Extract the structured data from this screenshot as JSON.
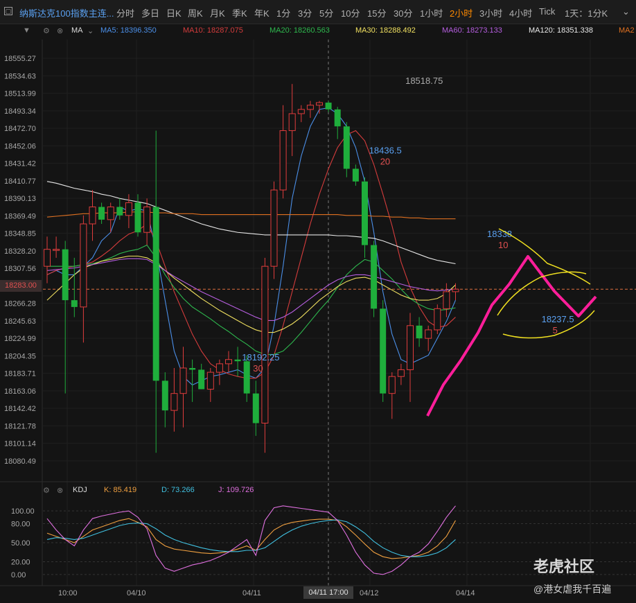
{
  "toolbar": {
    "symbol": "纳斯达克100指数主连...",
    "timeframes": [
      "分时",
      "多日",
      "日K",
      "周K",
      "月K",
      "季K",
      "年K",
      "1分",
      "3分",
      "5分",
      "10分",
      "15分",
      "30分",
      "1小时",
      "2小时",
      "3小时",
      "4小时",
      "Tick",
      "1天：1分K"
    ],
    "active_timeframe": "2小时"
  },
  "ma_bar": {
    "label": "MA",
    "items": [
      {
        "text": "MA5: 18396.350",
        "color": "#4b8fe8"
      },
      {
        "text": "MA10: 18287.075",
        "color": "#d43c3c"
      },
      {
        "text": "MA20: 18260.563",
        "color": "#2eb84e"
      },
      {
        "text": "MA30: 18288.492",
        "color": "#f0e060"
      },
      {
        "text": "MA60: 18273.133",
        "color": "#b65ee0"
      },
      {
        "text": "MA120: 18351.338",
        "color": "#e8e8e8"
      },
      {
        "text": "MA2",
        "color": "#e07020"
      }
    ]
  },
  "kdj_bar": {
    "label": "KDJ",
    "items": [
      {
        "text": "K: 85.419",
        "color": "#f0a040"
      },
      {
        "text": "D: 73.266",
        "color": "#40c0e0"
      },
      {
        "text": "J: 109.726",
        "color": "#e070e0"
      }
    ]
  },
  "price_chip": "18283.00",
  "crosshair_label": "04/11 17:00",
  "watermark": "老虎社区",
  "author": "@港女虐我千百遍",
  "colors": {
    "up": "#e03c3c",
    "down": "#1fae3c",
    "bg": "#141414",
    "grid": "#262626"
  },
  "chart_data": {
    "type": "candlestick",
    "y_ticks": [
      "18555.27",
      "18534.63",
      "18513.99",
      "18493.34",
      "18472.70",
      "18452.06",
      "18431.42",
      "18410.77",
      "18390.13",
      "18369.49",
      "18348.85",
      "18328.20",
      "18307.56",
      "18266.28",
      "18245.63",
      "18224.99",
      "18204.35",
      "18183.71",
      "18163.06",
      "18142.42",
      "18121.78",
      "18101.14",
      "18080.49"
    ],
    "ylim": [
      18060,
      18575
    ],
    "x_labels": [
      "10:00",
      "04/10",
      "04/11",
      "04/12",
      "04/14"
    ],
    "current_price": 18283.0,
    "annotations": [
      {
        "label": "18518.75",
        "x": 41,
        "y": 18518.75
      },
      {
        "label": "18436.5",
        "sub": "20",
        "x": 37,
        "y": 18436.5
      },
      {
        "label": "18338",
        "sub": "10",
        "x": 50,
        "y": 18338
      },
      {
        "label": "18237.5",
        "sub": "5",
        "x": 56,
        "y": 18237.5
      },
      {
        "label": "18192.25",
        "sub": "30",
        "x": 23,
        "y": 18192.25
      }
    ],
    "candles": [
      {
        "o": 18310,
        "h": 18345,
        "l": 18290,
        "c": 18330
      },
      {
        "o": 18330,
        "h": 18345,
        "l": 18320,
        "c": 18330
      },
      {
        "o": 18330,
        "h": 18340,
        "l": 18160,
        "c": 18270
      },
      {
        "o": 18270,
        "h": 18320,
        "l": 18250,
        "c": 18262
      },
      {
        "o": 18262,
        "h": 18370,
        "l": 18220,
        "c": 18360
      },
      {
        "o": 18360,
        "h": 18400,
        "l": 18340,
        "c": 18380
      },
      {
        "o": 18380,
        "h": 18385,
        "l": 18360,
        "c": 18365
      },
      {
        "o": 18365,
        "h": 18385,
        "l": 18350,
        "c": 18380
      },
      {
        "o": 18380,
        "h": 18390,
        "l": 18365,
        "c": 18370
      },
      {
        "o": 18370,
        "h": 18395,
        "l": 18355,
        "c": 18385
      },
      {
        "o": 18385,
        "h": 18395,
        "l": 18345,
        "c": 18350
      },
      {
        "o": 18350,
        "h": 18390,
        "l": 18335,
        "c": 18380
      },
      {
        "o": 18380,
        "h": 18470,
        "l": 18090,
        "c": 18175
      },
      {
        "o": 18175,
        "h": 18185,
        "l": 18120,
        "c": 18140
      },
      {
        "o": 18140,
        "h": 18190,
        "l": 18115,
        "c": 18160
      },
      {
        "o": 18160,
        "h": 18215,
        "l": 18120,
        "c": 18190
      },
      {
        "o": 18190,
        "h": 18200,
        "l": 18150,
        "c": 18188
      },
      {
        "o": 18188,
        "h": 18195,
        "l": 18165,
        "c": 18165
      },
      {
        "o": 18165,
        "h": 18190,
        "l": 18150,
        "c": 18185
      },
      {
        "o": 18185,
        "h": 18200,
        "l": 18170,
        "c": 18195
      },
      {
        "o": 18195,
        "h": 18210,
        "l": 18185,
        "c": 18200
      },
      {
        "o": 18200,
        "h": 18215,
        "l": 18180,
        "c": 18198
      },
      {
        "o": 18198,
        "h": 18205,
        "l": 18150,
        "c": 18160
      },
      {
        "o": 18160,
        "h": 18175,
        "l": 18110,
        "c": 18125
      },
      {
        "o": 18125,
        "h": 18320,
        "l": 18090,
        "c": 18310
      },
      {
        "o": 18310,
        "h": 18410,
        "l": 18295,
        "c": 18400
      },
      {
        "o": 18400,
        "h": 18500,
        "l": 18390,
        "c": 18470
      },
      {
        "o": 18470,
        "h": 18525,
        "l": 18440,
        "c": 18490
      },
      {
        "o": 18490,
        "h": 18500,
        "l": 18480,
        "c": 18495
      },
      {
        "o": 18495,
        "h": 18505,
        "l": 18485,
        "c": 18500
      },
      {
        "o": 18500,
        "h": 18505,
        "l": 18490,
        "c": 18503
      },
      {
        "o": 18503,
        "h": 18505,
        "l": 18492,
        "c": 18495
      },
      {
        "o": 18495,
        "h": 18498,
        "l": 18460,
        "c": 18475
      },
      {
        "o": 18475,
        "h": 18480,
        "l": 18415,
        "c": 18425
      },
      {
        "o": 18425,
        "h": 18430,
        "l": 18405,
        "c": 18410
      },
      {
        "o": 18410,
        "h": 18415,
        "l": 18320,
        "c": 18335
      },
      {
        "o": 18335,
        "h": 18340,
        "l": 18250,
        "c": 18260
      },
      {
        "o": 18260,
        "h": 18270,
        "l": 18150,
        "c": 18160
      },
      {
        "o": 18160,
        "h": 18185,
        "l": 18130,
        "c": 18180
      },
      {
        "o": 18180,
        "h": 18195,
        "l": 18170,
        "c": 18188
      },
      {
        "o": 18188,
        "h": 18255,
        "l": 18150,
        "c": 18240
      },
      {
        "o": 18240,
        "h": 18250,
        "l": 18215,
        "c": 18225
      },
      {
        "o": 18225,
        "h": 18240,
        "l": 18210,
        "c": 18235
      },
      {
        "o": 18235,
        "h": 18265,
        "l": 18230,
        "c": 18260
      },
      {
        "o": 18260,
        "h": 18290,
        "l": 18250,
        "c": 18280
      },
      {
        "o": 18280,
        "h": 18290,
        "l": 18270,
        "c": 18283
      }
    ],
    "series": [
      {
        "name": "MA5",
        "color": "#4b8fe8",
        "values": [
          18300,
          18305,
          18300,
          18300,
          18310,
          18320,
          18340,
          18350,
          18380,
          18375,
          18378,
          18375,
          18330,
          18270,
          18210,
          18180,
          18170,
          18175,
          18180,
          18182,
          18185,
          18188,
          18182,
          18178,
          18190,
          18240,
          18310,
          18390,
          18440,
          18475,
          18495,
          18497,
          18490,
          18475,
          18450,
          18410,
          18350,
          18280,
          18230,
          18200,
          18195,
          18200,
          18205,
          18225,
          18245,
          18270
        ]
      },
      {
        "name": "MA10",
        "color": "#d43c3c",
        "values": [
          18300,
          18305,
          18308,
          18310,
          18312,
          18315,
          18322,
          18330,
          18340,
          18348,
          18352,
          18360,
          18340,
          18310,
          18280,
          18255,
          18230,
          18210,
          18195,
          18188,
          18183,
          18180,
          18178,
          18178,
          18185,
          18205,
          18240,
          18280,
          18320,
          18360,
          18395,
          18425,
          18450,
          18465,
          18470,
          18458,
          18430,
          18395,
          18358,
          18315,
          18285,
          18262,
          18245,
          18238,
          18240,
          18250
        ]
      },
      {
        "name": "MA20",
        "color": "#2eb84e",
        "values": [
          18310,
          18310,
          18310,
          18310,
          18312,
          18313,
          18316,
          18320,
          18325,
          18328,
          18330,
          18335,
          18320,
          18300,
          18285,
          18272,
          18262,
          18255,
          18248,
          18240,
          18233,
          18225,
          18218,
          18210,
          18206,
          18206,
          18210,
          18220,
          18232,
          18245,
          18258,
          18270,
          18285,
          18300,
          18310,
          18318,
          18315,
          18305,
          18295,
          18283,
          18272,
          18265,
          18260,
          18258,
          18259,
          18261
        ]
      },
      {
        "name": "MA30",
        "color": "#f0e060",
        "values": [
          18270,
          18280,
          18290,
          18300,
          18308,
          18312,
          18316,
          18318,
          18320,
          18322,
          18322,
          18320,
          18314,
          18305,
          18296,
          18288,
          18280,
          18272,
          18265,
          18258,
          18252,
          18246,
          18240,
          18235,
          18232,
          18232,
          18236,
          18242,
          18250,
          18260,
          18270,
          18278,
          18286,
          18292,
          18296,
          18297,
          18294,
          18288,
          18282,
          18276,
          18272,
          18270,
          18270,
          18272,
          18278,
          18288
        ]
      },
      {
        "name": "MA60",
        "color": "#b65ee0",
        "values": [
          18305,
          18306,
          18307,
          18308,
          18310,
          18312,
          18314,
          18316,
          18318,
          18319,
          18319,
          18318,
          18312,
          18305,
          18298,
          18292,
          18286,
          18280,
          18275,
          18270,
          18265,
          18260,
          18255,
          18250,
          18246,
          18246,
          18250,
          18256,
          18264,
          18272,
          18280,
          18288,
          18294,
          18298,
          18300,
          18300,
          18298,
          18295,
          18292,
          18289,
          18286,
          18284,
          18282,
          18281,
          18282,
          18283
        ]
      },
      {
        "name": "MA120",
        "color": "#e8e8e8",
        "values": [
          18410,
          18408,
          18405,
          18402,
          18400,
          18398,
          18395,
          18393,
          18390,
          18388,
          18386,
          18384,
          18380,
          18376,
          18372,
          18368,
          18364,
          18360,
          18357,
          18354,
          18352,
          18350,
          18349,
          18348,
          18347,
          18347,
          18347,
          18347,
          18347,
          18347,
          18347,
          18347,
          18346,
          18346,
          18345,
          18344,
          18343,
          18340,
          18336,
          18332,
          18328,
          18324,
          18320,
          18317,
          18315,
          18313
        ]
      },
      {
        "name": "MA250",
        "color": "#e07020",
        "values": [
          18368,
          18369,
          18370,
          18371,
          18372,
          18372,
          18373,
          18373,
          18373,
          18374,
          18374,
          18374,
          18373,
          18373,
          18372,
          18372,
          18372,
          18371,
          18371,
          18371,
          18371,
          18371,
          18371,
          18371,
          18371,
          18371,
          18371,
          18371,
          18371,
          18371,
          18371,
          18371,
          18371,
          18370,
          18370,
          18370,
          18369,
          18369,
          18368,
          18368,
          18367,
          18367,
          18366,
          18366,
          18366,
          18366
        ]
      }
    ],
    "kdj": {
      "ylim": [
        -10,
        110
      ],
      "y_ticks": [
        "100.00",
        "80.00",
        "50.00",
        "20.00",
        "0.00"
      ],
      "series": [
        {
          "name": "K",
          "color": "#f0a040",
          "values": [
            65,
            60,
            55,
            50,
            60,
            70,
            75,
            80,
            85,
            88,
            82,
            75,
            55,
            45,
            40,
            38,
            36,
            34,
            33,
            34,
            36,
            40,
            45,
            38,
            55,
            70,
            78,
            82,
            84,
            86,
            87,
            87,
            85,
            75,
            62,
            48,
            35,
            28,
            25,
            26,
            28,
            30,
            35,
            45,
            60,
            85
          ]
        },
        {
          "name": "D",
          "color": "#40c0e0",
          "values": [
            55,
            58,
            57,
            55,
            57,
            62,
            67,
            72,
            77,
            80,
            81,
            80,
            72,
            62,
            55,
            50,
            46,
            42,
            39,
            37,
            36,
            36,
            38,
            38,
            42,
            52,
            62,
            70,
            76,
            80,
            83,
            85,
            86,
            83,
            75,
            65,
            52,
            42,
            35,
            30,
            28,
            28,
            30,
            34,
            42,
            55
          ]
        },
        {
          "name": "J",
          "color": "#e070e0",
          "values": [
            88,
            70,
            55,
            45,
            70,
            88,
            92,
            95,
            98,
            100,
            90,
            72,
            30,
            10,
            5,
            10,
            15,
            18,
            22,
            28,
            35,
            45,
            55,
            30,
            85,
            105,
            108,
            106,
            104,
            102,
            100,
            98,
            85,
            62,
            35,
            15,
            2,
            0,
            5,
            15,
            28,
            35,
            48,
            68,
            90,
            108
          ]
        }
      ]
    }
  }
}
